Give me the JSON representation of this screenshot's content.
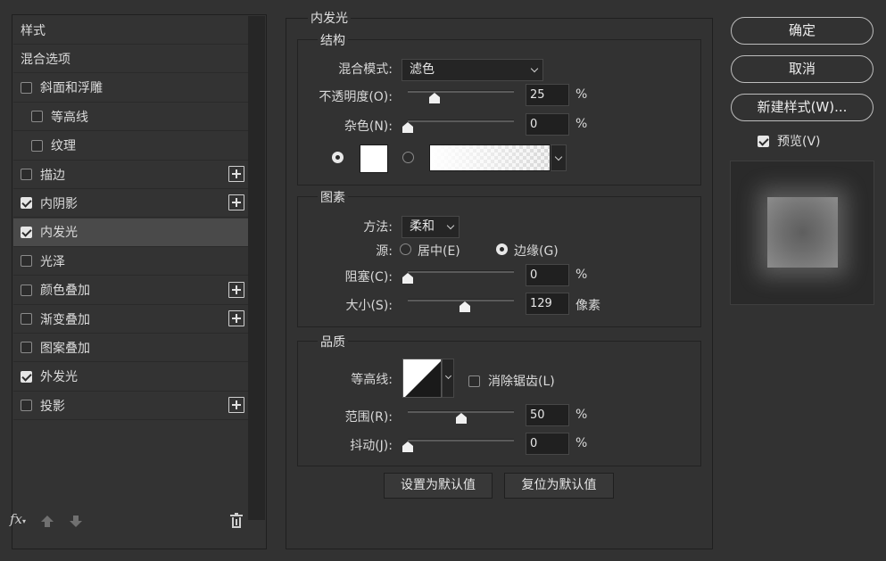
{
  "left_panel": {
    "items": [
      {
        "label": "样式",
        "has_checkbox": false,
        "checked": false,
        "has_plus": false,
        "selected": false,
        "indent": false
      },
      {
        "label": "混合选项",
        "has_checkbox": false,
        "checked": false,
        "has_plus": false,
        "selected": false,
        "indent": false
      },
      {
        "label": "斜面和浮雕",
        "has_checkbox": true,
        "checked": false,
        "has_plus": false,
        "selected": false,
        "indent": false
      },
      {
        "label": "等高线",
        "has_checkbox": true,
        "checked": false,
        "has_plus": false,
        "selected": false,
        "indent": true
      },
      {
        "label": "纹理",
        "has_checkbox": true,
        "checked": false,
        "has_plus": false,
        "selected": false,
        "indent": true
      },
      {
        "label": "描边",
        "has_checkbox": true,
        "checked": false,
        "has_plus": true,
        "selected": false,
        "indent": false
      },
      {
        "label": "内阴影",
        "has_checkbox": true,
        "checked": true,
        "has_plus": true,
        "selected": false,
        "indent": false
      },
      {
        "label": "内发光",
        "has_checkbox": true,
        "checked": true,
        "has_plus": false,
        "selected": true,
        "indent": false
      },
      {
        "label": "光泽",
        "has_checkbox": true,
        "checked": false,
        "has_plus": false,
        "selected": false,
        "indent": false
      },
      {
        "label": "颜色叠加",
        "has_checkbox": true,
        "checked": false,
        "has_plus": true,
        "selected": false,
        "indent": false
      },
      {
        "label": "渐变叠加",
        "has_checkbox": true,
        "checked": false,
        "has_plus": true,
        "selected": false,
        "indent": false
      },
      {
        "label": "图案叠加",
        "has_checkbox": true,
        "checked": false,
        "has_plus": false,
        "selected": false,
        "indent": false
      },
      {
        "label": "外发光",
        "has_checkbox": true,
        "checked": true,
        "has_plus": false,
        "selected": false,
        "indent": false
      },
      {
        "label": "投影",
        "has_checkbox": true,
        "checked": false,
        "has_plus": true,
        "selected": false,
        "indent": false
      }
    ],
    "footer": {
      "fx": "fx"
    }
  },
  "main": {
    "title": "内发光",
    "structure": {
      "title": "结构",
      "blend_mode_label": "混合模式:",
      "blend_mode_value": "滤色",
      "opacity_label": "不透明度(O):",
      "opacity_value": "25",
      "opacity_unit": "%",
      "opacity_fraction": 0.25,
      "noise_label": "杂色(N):",
      "noise_value": "0",
      "noise_unit": "%",
      "noise_fraction": 0.0,
      "color_mode": "solid",
      "color": "#ffffff"
    },
    "elements": {
      "title": "图素",
      "method_label": "方法:",
      "method_value": "柔和",
      "source_label": "源:",
      "source_center": "居中(E)",
      "source_edge": "边缘(G)",
      "source_selected": "edge",
      "choke_label": "阻塞(C):",
      "choke_value": "0",
      "choke_unit": "%",
      "choke_fraction": 0.0,
      "size_label": "大小(S):",
      "size_value": "129",
      "size_unit": "像素",
      "size_fraction": 0.54
    },
    "quality": {
      "title": "品质",
      "contour_label": "等高线:",
      "antialias_label": "消除锯齿(L)",
      "antialias_checked": false,
      "range_label": "范围(R):",
      "range_value": "50",
      "range_unit": "%",
      "range_fraction": 0.5,
      "jitter_label": "抖动(J):",
      "jitter_value": "0",
      "jitter_unit": "%",
      "jitter_fraction": 0.0
    },
    "make_default": "设置为默认值",
    "reset_default": "复位为默认值"
  },
  "right": {
    "ok": "确定",
    "cancel": "取消",
    "new_style": "新建样式(W)...",
    "preview_label": "预览(V)",
    "preview_checked": true
  }
}
